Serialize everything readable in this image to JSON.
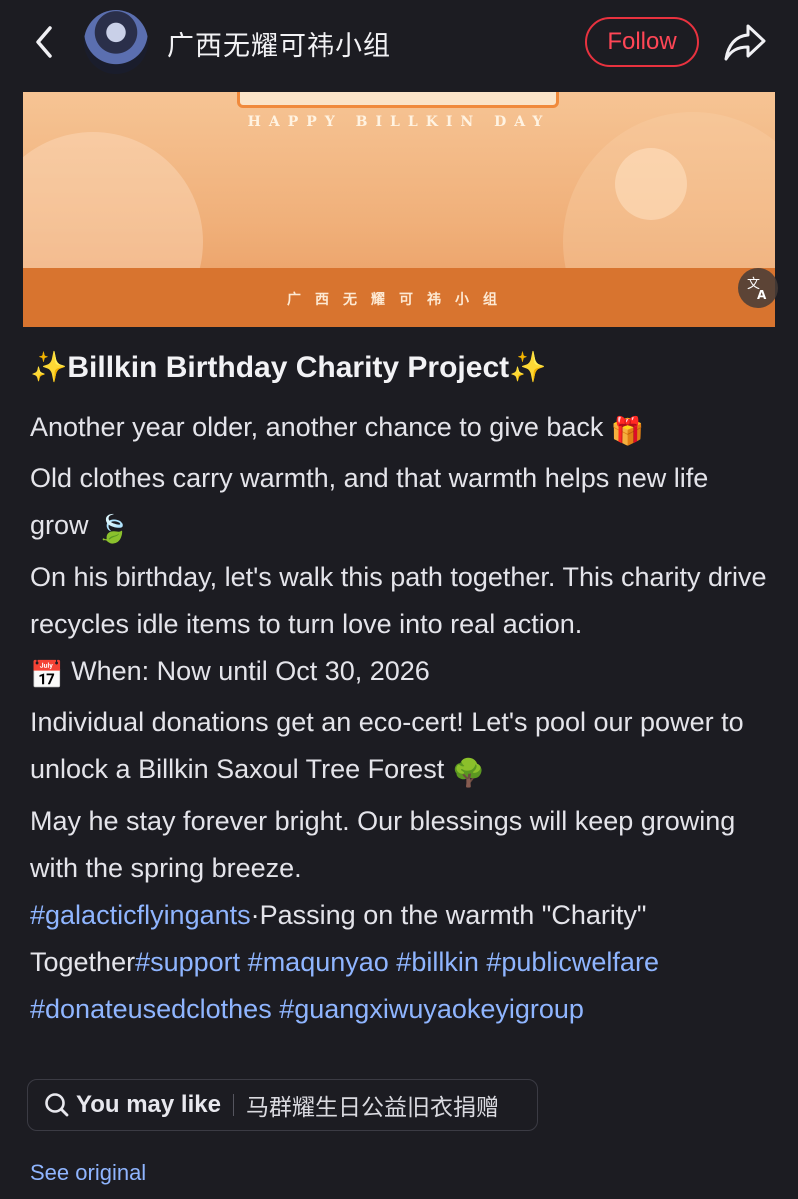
{
  "header": {
    "group_name": "广西无耀可祎小组",
    "follow_label": "Follow"
  },
  "banner": {
    "subtitle": "HAPPY BILLKIN DAY",
    "band_text": "广西无耀可祎小组"
  },
  "post": {
    "title_prefix": "✨",
    "title": "Billkin Birthday Charity Project",
    "title_suffix": "✨",
    "line1": "Another year older, another chance to give back",
    "line1_emoji": "🎁",
    "line2": "Old clothes carry warmth, and that warmth helps new life grow",
    "line2_emoji": "🍃",
    "line3": "On his birthday, let's walk this path together. This charity drive recycles idle items to turn love into real action.",
    "when_emoji": "📅",
    "when": "When: Now until Oct 30, 2026",
    "line5": "Individual donations get an eco-cert! Let's pool our power to unlock a Billkin Saxoul Tree Forest",
    "line5_emoji": "🌳",
    "line6": "May he stay forever bright. Our blessings will keep growing with the spring breeze.",
    "tag_galactic": "#galacticflyingants",
    "passing_text": "·Passing on the warmth \"Charity\" Together",
    "tag_support": "#support",
    "tag_maqunyao": "#maqunyao",
    "tag_billkin": "#billkin",
    "tag_publicwelfare": "#publicwelfare",
    "tag_donate": "#donateusedclothes",
    "tag_group": "#guangxiwuyaokeyigroup"
  },
  "may_like": {
    "label": "You may like",
    "query": "马群耀生日公益旧衣捐赠"
  },
  "see_original": "See original",
  "colors": {
    "background": "#1c1c22",
    "accent_red": "#ff4656",
    "link_blue": "#8fb5ff",
    "banner_orange": "#d8742f"
  },
  "icons": [
    "chevron-left-icon",
    "share-icon",
    "translate-icon",
    "search-icon"
  ]
}
